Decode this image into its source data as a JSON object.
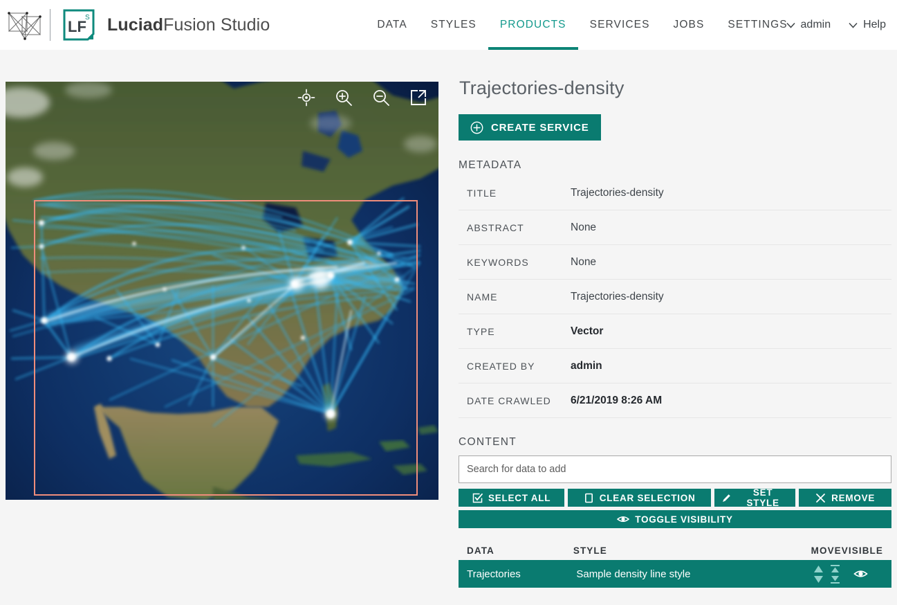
{
  "header": {
    "brand_bold": "Luciad",
    "brand_light": "Fusion Studio",
    "logo_letters": "LF",
    "logo_super": "S",
    "nav": [
      {
        "label": "DATA",
        "active": false
      },
      {
        "label": "STYLES",
        "active": false
      },
      {
        "label": "PRODUCTS",
        "active": true
      },
      {
        "label": "SERVICES",
        "active": false
      },
      {
        "label": "JOBS",
        "active": false
      },
      {
        "label": "SETTINGS",
        "active": false
      }
    ],
    "user_label": "admin",
    "help_label": "Help"
  },
  "map": {
    "tools": [
      "locate-icon",
      "zoom-in-icon",
      "zoom-out-icon",
      "fullscreen-icon"
    ],
    "bbox_color": "#ef8d7b",
    "trajectory_color": "#2eb7f5"
  },
  "panel": {
    "title": "Trajectories-density",
    "create_service_label": "CREATE SERVICE",
    "metadata_label": "METADATA",
    "metadata": [
      {
        "key": "TITLE",
        "value": "Trajectories-density",
        "strong": false
      },
      {
        "key": "ABSTRACT",
        "value": "None",
        "strong": false
      },
      {
        "key": "KEYWORDS",
        "value": "None",
        "strong": false
      },
      {
        "key": "NAME",
        "value": "Trajectories-density",
        "strong": false
      },
      {
        "key": "TYPE",
        "value": "Vector",
        "strong": true
      },
      {
        "key": "CREATED BY",
        "value": "admin",
        "strong": true
      },
      {
        "key": "DATE CRAWLED",
        "value": "6/21/2019 8:26 AM",
        "strong": true
      }
    ],
    "content_label": "CONTENT",
    "search_placeholder": "Search for data to add",
    "search_value": "",
    "buttons": {
      "select_all": "SELECT ALL",
      "clear_selection": "CLEAR SELECTION",
      "set_style": "SET STYLE",
      "remove": "REMOVE",
      "toggle_visibility": "TOGGLE VISIBILITY"
    },
    "table": {
      "headers": {
        "data": "DATA",
        "style": "STYLE",
        "move": "MOVE",
        "visible": "VISIBLE"
      },
      "rows": [
        {
          "data": "Trajectories",
          "style": "Sample density line style",
          "selected": true
        }
      ]
    }
  },
  "colors": {
    "accent_teal": "#0a7b70",
    "accent_teal_light": "#12998c",
    "page_bg": "#f5f5f5",
    "header_bg": "#ffffff",
    "bbox_salmon": "#ef8d7b"
  }
}
